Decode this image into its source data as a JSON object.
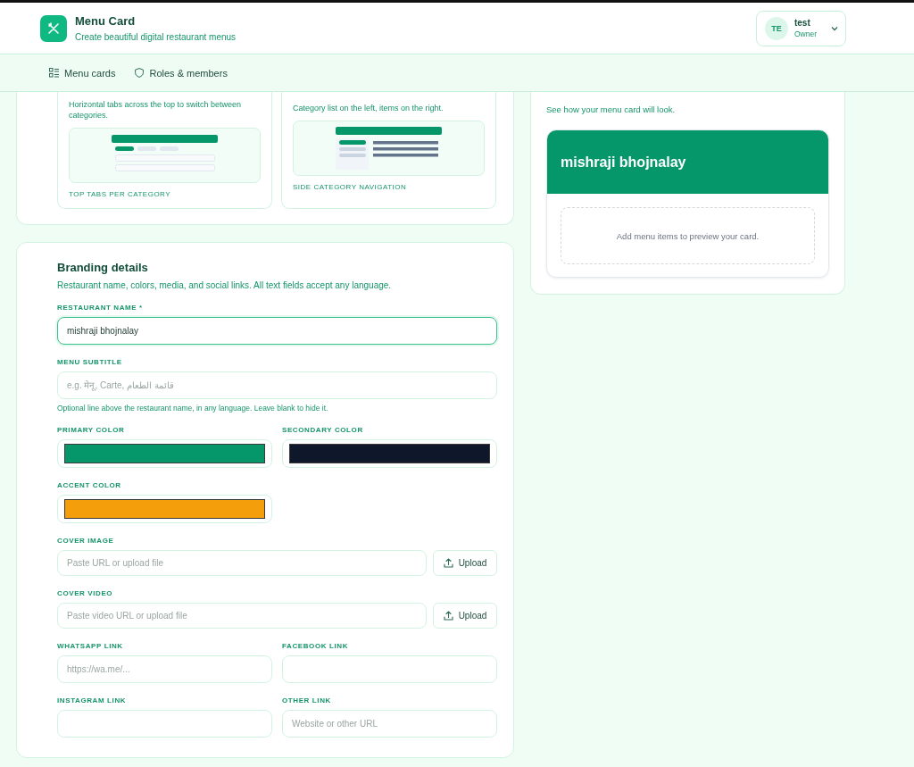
{
  "app": {
    "title": "Menu Card",
    "subtitle": "Create beautiful digital restaurant menus"
  },
  "user": {
    "initials": "TE",
    "name": "test",
    "role": "Owner"
  },
  "nav": [
    {
      "label": "Menu cards"
    },
    {
      "label": "Roles & members"
    }
  ],
  "layout_options": [
    {
      "kind": "tabs",
      "description": "Horizontal tabs across the top to switch between categories.",
      "caption": "TOP TABS PER CATEGORY"
    },
    {
      "kind": "side",
      "description": "Category list on the left, items on the right.",
      "caption": "SIDE CATEGORY NAVIGATION"
    }
  ],
  "branding": {
    "title": "Branding details",
    "description": "Restaurant name, colors, media, and social links. All text fields accept any language.",
    "rows": [
      [
        {
          "kind": "text",
          "label": "RESTAURANT NAME *",
          "value": "mishraji bhojnalay",
          "focused": true
        }
      ],
      [
        {
          "kind": "text",
          "label": "MENU SUBTITLE",
          "placeholder": "e.g. मेनू, Carte, قائمة الطعام",
          "hint": "Optional line above the restaurant name, in any language. Leave blank to hide it.",
          "focused": false
        }
      ],
      [
        {
          "kind": "color",
          "label": "PRIMARY COLOR",
          "color": "#059669"
        },
        {
          "kind": "color",
          "label": "SECONDARY COLOR",
          "color": "#0f172a"
        }
      ],
      [
        {
          "kind": "color",
          "label": "ACCENT COLOR",
          "color": "#f59e0b"
        }
      ],
      [
        {
          "kind": "upload",
          "label": "COVER IMAGE",
          "placeholder": "Paste URL or upload file",
          "button": "Upload"
        }
      ],
      [
        {
          "kind": "upload",
          "label": "COVER VIDEO",
          "placeholder": "Paste video URL or upload file",
          "button": "Upload"
        }
      ],
      [
        {
          "kind": "text",
          "label": "WHATSAPP LINK",
          "placeholder": "https://wa.me/...",
          "focused": false
        },
        {
          "kind": "text",
          "label": "FACEBOOK LINK",
          "focused": false
        }
      ],
      [
        {
          "kind": "text",
          "label": "INSTAGRAM LINK",
          "focused": false
        },
        {
          "kind": "text",
          "label": "OTHER LINK",
          "placeholder": "Website or other URL",
          "focused": false
        }
      ]
    ]
  },
  "preview": {
    "description": "See how your menu card will look.",
    "restaurant_name": "mishraji bhojnalay",
    "empty_message": "Add menu items to preview your card."
  }
}
